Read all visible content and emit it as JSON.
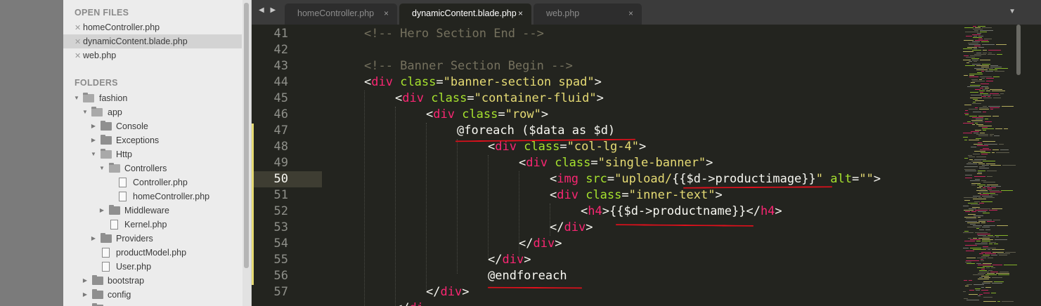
{
  "sidebar": {
    "open_files_header": "OPEN FILES",
    "open_files": [
      {
        "name": "homeController.php"
      },
      {
        "name": "dynamicContent.blade.php"
      },
      {
        "name": "web.php"
      }
    ],
    "folders_header": "FOLDERS",
    "tree": [
      {
        "label": "fashion"
      },
      {
        "label": "app"
      },
      {
        "label": "Console"
      },
      {
        "label": "Exceptions"
      },
      {
        "label": "Http"
      },
      {
        "label": "Controllers"
      },
      {
        "label": "Controller.php"
      },
      {
        "label": "homeController.php"
      },
      {
        "label": "Middleware"
      },
      {
        "label": "Kernel.php"
      },
      {
        "label": "Providers"
      },
      {
        "label": "productModel.php"
      },
      {
        "label": "User.php"
      },
      {
        "label": "bootstrap"
      },
      {
        "label": "config"
      }
    ]
  },
  "tabs": [
    {
      "label": "homeController.php",
      "close": "×"
    },
    {
      "label": "dynamicContent.blade.php",
      "close": "×"
    },
    {
      "label": "web.php",
      "close": "×"
    }
  ],
  "nav": {
    "arrows": "◀ ▶",
    "dropdown": "▼"
  },
  "editor": {
    "lines": [
      {
        "n": "41"
      },
      {
        "n": "42"
      },
      {
        "n": "43"
      },
      {
        "n": "44"
      },
      {
        "n": "45"
      },
      {
        "n": "46"
      },
      {
        "n": "47"
      },
      {
        "n": "48"
      },
      {
        "n": "49"
      },
      {
        "n": "50"
      },
      {
        "n": "51"
      },
      {
        "n": "52"
      },
      {
        "n": "53"
      },
      {
        "n": "54"
      },
      {
        "n": "55"
      },
      {
        "n": "56"
      },
      {
        "n": "57"
      }
    ],
    "code": {
      "l41": "<!-- Hero Section End -->",
      "l43": "<!-- Banner Section Begin -->",
      "l44": {
        "open": "<",
        "tag": "div",
        "attr": " class",
        "eq": "=",
        "val": "\"banner-section spad\"",
        "close": ">"
      },
      "l45": {
        "open": "<",
        "tag": "div",
        "attr": " class",
        "eq": "=",
        "val": "\"container-fluid\"",
        "close": ">"
      },
      "l46": {
        "open": "<",
        "tag": "div",
        "attr": " class",
        "eq": "=",
        "val": "\"row\"",
        "close": ">"
      },
      "l47": "@foreach ($data as $d)",
      "l48": {
        "open": "<",
        "tag": "div",
        "attr": " class",
        "eq": "=",
        "val": "\"col-lg-4\"",
        "close": ">"
      },
      "l49": {
        "open": "<",
        "tag": "div",
        "attr": " class",
        "eq": "=",
        "val": "\"single-banner\"",
        "close": ">"
      },
      "l50": {
        "open": "<",
        "tag": "img",
        "attr": " src",
        "eq": "=",
        "val1": "\"upload/",
        "blade": "{{$d->productimage}}",
        "val2": "\"",
        "attr2": " alt",
        "eq2": "=",
        "val3": "\"\"",
        "close": ">"
      },
      "l51": {
        "open": "<",
        "tag": "div",
        "attr": " class",
        "eq": "=",
        "val": "\"inner-text\"",
        "close": ">"
      },
      "l52": {
        "open": "<",
        "tag": "h4",
        "close": ">",
        "blade": "{{$d->productname}}",
        "open2": "</",
        "tag2": "h4",
        "close2": ">"
      },
      "l53": {
        "open": "</",
        "tag": "div",
        "close": ">"
      },
      "l54": {
        "open": "</",
        "tag": "div",
        "close": ">"
      },
      "l55": {
        "open": "</",
        "tag": "div",
        "close": ">"
      },
      "l56": "@endforeach",
      "l57": {
        "open": "</",
        "tag": "div",
        "close": ">"
      },
      "l58": {
        "open": "</",
        "tag": "di"
      }
    }
  },
  "colors": {
    "background": "#23241f",
    "comment": "#75715e",
    "tag": "#f92672",
    "attribute": "#a6e22e",
    "string": "#e6db74",
    "text": "#f8f8f2",
    "annotation": "#e0101c"
  }
}
